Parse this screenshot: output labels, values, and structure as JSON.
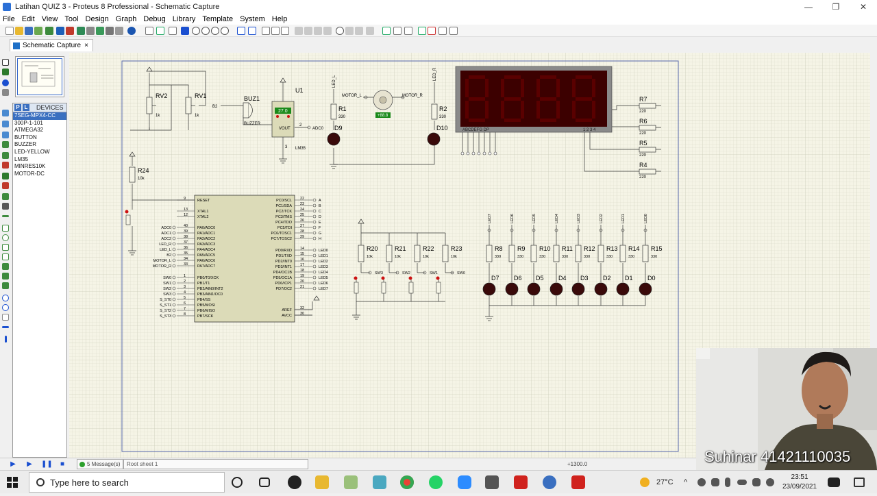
{
  "window": {
    "title": "Latihan QUIZ 3 - Proteus 8 Professional - Schematic Capture",
    "minimize": "—",
    "maximize": "❐",
    "close": "✕"
  },
  "menu": [
    "File",
    "Edit",
    "View",
    "Tool",
    "Design",
    "Graph",
    "Debug",
    "Library",
    "Template",
    "System",
    "Help"
  ],
  "tab": {
    "label": "Schematic Capture",
    "close": "×"
  },
  "devices": {
    "p_button": "P",
    "l_button": "L",
    "header": "DEVICES",
    "items": [
      "7SEG-MPX4-CC",
      "300P-1-101",
      "ATMEGA32",
      "BUTTON",
      "BUZZER",
      "LED-YELLOW",
      "LM35",
      "MINRES10K",
      "MOTOR-DC"
    ],
    "selected_index": 0
  },
  "schematic": {
    "rv2": "RV2",
    "rv1": "RV1",
    "k1": "1k",
    "k2": "1k",
    "b2": "B2",
    "buz1": "BUZ1",
    "buzzer": "BUZZER",
    "u1": "U1",
    "lm35": "LM35",
    "lm35_temp": "27.0",
    "vout": "VOUT",
    "adc0": "ADC0",
    "pin2": "2",
    "pin3": "3",
    "led_l": "LED_L",
    "led_r": "LED_R",
    "r1": "R1",
    "r1v": "330",
    "d9": "D9",
    "r2": "R2",
    "r2v": "330",
    "d10": "D10",
    "motor_l": "MOTOR_L",
    "motor_r": "MOTOR_R",
    "motor_speed": "+88.8",
    "seg_abc": "ABCDEFG  DP",
    "seg_digits": "1 2 3 4",
    "r7": "R7",
    "r6": "R6",
    "r5": "R5",
    "r4": "R4",
    "rv220": "220",
    "r24": "R24",
    "r24v": "10k",
    "mcu_left_pins": [
      "RESET",
      "XTAL1",
      "XTAL2",
      "PA0/ADC0",
      "PA1/ADC1",
      "PA2/ADC2",
      "PA3/ADC3",
      "PA4/ADC4",
      "PA5/ADC5",
      "PA6/ADC6",
      "PA7/ADC7",
      "PB0/T0/XCK",
      "PB1/T1",
      "PB2/AIN0/INT2",
      "PB3/AIN1/OC0",
      "PB4/SS",
      "PB5/MOSI",
      "PB6/MISO",
      "PB7/SCK"
    ],
    "mcu_left_nums": [
      "9",
      "13",
      "12",
      "40",
      "39",
      "38",
      "37",
      "36",
      "35",
      "34",
      "33",
      "1",
      "2",
      "3",
      "4",
      "5",
      "6",
      "7",
      "8"
    ],
    "mcu_left_nets": [
      "",
      "",
      "",
      "ADC0",
      "ADC1",
      "ADC2",
      "LED_R",
      "LED_L",
      "B2",
      "MOTOR_L",
      "MOTOR_R",
      "SW0",
      "SW1",
      "SW2",
      "SW3",
      "S_ST0",
      "S_ST1",
      "S_ST2",
      "S_ST3"
    ],
    "mcu_right_pins": [
      "PC0/SCL",
      "PC1/SDA",
      "PC2/TCK",
      "PC3/TMS",
      "PC4/TDO",
      "PC5/TDI",
      "PC6/TOSC1",
      "PC7/TOSC2",
      "PD0/RXD",
      "PD1/TXD",
      "PD2/INT0",
      "PD3/INT1",
      "PD4/OC1B",
      "PD5/OC1A",
      "PD6/ICP1",
      "PD7/OC2",
      "AREF",
      "AVCC"
    ],
    "mcu_right_nums": [
      "22",
      "23",
      "24",
      "25",
      "26",
      "27",
      "28",
      "29",
      "14",
      "15",
      "16",
      "17",
      "18",
      "19",
      "20",
      "21",
      "32",
      "30"
    ],
    "mcu_right_nets": [
      "A",
      "B",
      "C",
      "D",
      "E",
      "F",
      "G",
      "H",
      "LED0",
      "LED1",
      "LED2",
      "LED3",
      "LED4",
      "LED5",
      "LED6",
      "LED7",
      "",
      ""
    ],
    "sw_resistors": [
      "R20",
      "R21",
      "R22",
      "R23"
    ],
    "sw_rv": "10k",
    "switches": [
      "SW3",
      "SW2",
      "SW1",
      "SW0"
    ],
    "led_resistors": [
      "R8",
      "R9",
      "R10",
      "R11",
      "R12",
      "R13",
      "R14",
      "R15"
    ],
    "led_rv": "330",
    "led_nets": [
      "LED7",
      "LED6",
      "LED5",
      "LED4",
      "LED3",
      "LED2",
      "LED1",
      "LED0"
    ],
    "leds": [
      "D7",
      "D6",
      "D5",
      "D4",
      "D3",
      "D2",
      "D1",
      "D0"
    ]
  },
  "status": {
    "messages": "5 Message(s)",
    "sheet": "Root sheet 1",
    "coord": "+1300.0"
  },
  "taskbar": {
    "search_placeholder": "Type here to search",
    "temperature": "27°C",
    "time": "23:51",
    "date": "23/09/2021"
  },
  "webcam": {
    "caption": "Suhinar  4142111003​5"
  }
}
